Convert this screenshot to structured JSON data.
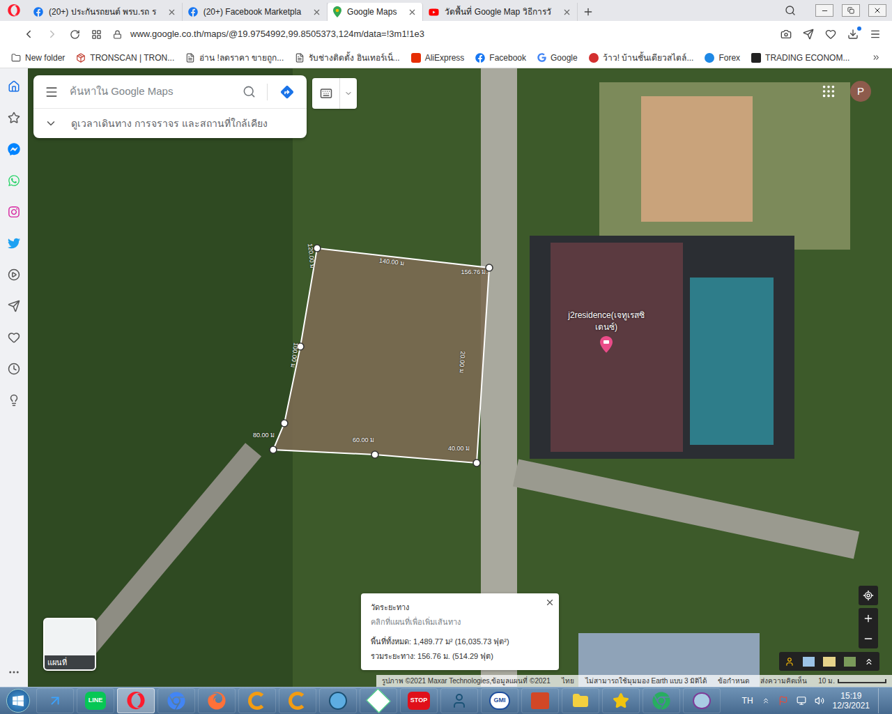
{
  "tabs": [
    {
      "label": "(20+) ประกันรถยนต์ พรบ.รถ ร",
      "selected": false
    },
    {
      "label": "(20+) Facebook Marketpla",
      "selected": false
    },
    {
      "label": "Google Maps",
      "selected": true
    },
    {
      "label": "วัดพื้นที่ Google Map วิธีการวั",
      "selected": false
    }
  ],
  "url": "www.google.co.th/maps/@19.9754992,99.8505373,124m/data=!3m1!1e3",
  "bookmarks": [
    "New folder",
    "TRONSCAN | TRON...",
    "อ่าน !ลดราคา ขายถูก...",
    "รับช่างติดตั้ง อินเทอร์เน็...",
    "AliExpress",
    "Facebook",
    "Google",
    "ว้าว! บ้านชั้นเดียวสไตล์...",
    "Forex",
    "TRADING ECONOM..."
  ],
  "sidebar": [
    {
      "selected": true
    },
    {
      "selected": false
    },
    {
      "selected": false
    },
    {
      "selected": false
    },
    {
      "selected": false
    },
    {
      "selected": false
    },
    {
      "selected": false
    },
    {
      "selected": false
    },
    {
      "selected": false
    },
    {
      "selected": false
    },
    {
      "selected": false
    }
  ],
  "map": {
    "search_placeholder": "ค้นหาใน Google Maps",
    "nearby": "ดูเวลาเดินทาง การจราจร และสถานที่ใกล้เคียง",
    "avatar": "P",
    "place": "j2residence(เจทูเรสซิเดนซ์)",
    "measure_labels": [
      "120.00 ม",
      "140.00 ม",
      "156.76 ม.",
      "100.00 ม",
      "20.00 ม",
      "80.00 ม",
      "60.00 ม",
      "40.00 ม"
    ],
    "measure_panel": {
      "title": "วัดระยะทาง",
      "hint": "คลิกที่แผนที่เพื่อเพิ่มเส้นทาง",
      "area": "พื้นที่ทั้งหมด: 1,489.77 ม² (16,035.73 ฟุต²)",
      "distance": "รวมระยะทาง: 156.76 ม. (514.29 ฟุต)"
    },
    "thumbnail_label": "แผนที่",
    "attribution": [
      "รูปภาพ ©2021 Maxar Technologies,ข้อมูลแผนที่ ©2021",
      "ไทย",
      "ไม่สามารถใช้มุมมอง Earth แบบ 3 มิติได้",
      "ข้อกำหนด",
      "ส่งความคิดเห็น"
    ],
    "scale": "10 ม."
  },
  "taskbar": {
    "apps": [
      {
        "text": "",
        "selected": false
      },
      {
        "text": "LINE",
        "selected": false
      },
      {
        "text": "",
        "selected": true
      },
      {
        "text": "",
        "selected": false
      },
      {
        "text": "",
        "selected": false
      },
      {
        "text": "",
        "selected": false
      },
      {
        "text": "",
        "selected": false
      },
      {
        "text": "",
        "selected": false
      },
      {
        "text": "",
        "selected": false
      },
      {
        "text": "STOP",
        "selected": false
      },
      {
        "text": "",
        "selected": false
      },
      {
        "text": "GMI",
        "selected": false
      },
      {
        "text": "",
        "selected": false
      },
      {
        "text": "",
        "selected": false
      },
      {
        "text": "",
        "selected": false
      },
      {
        "text": "",
        "selected": false
      },
      {
        "text": "",
        "selected": false
      }
    ],
    "language": "TH",
    "time": "15:19",
    "date": "12/3/2021"
  }
}
